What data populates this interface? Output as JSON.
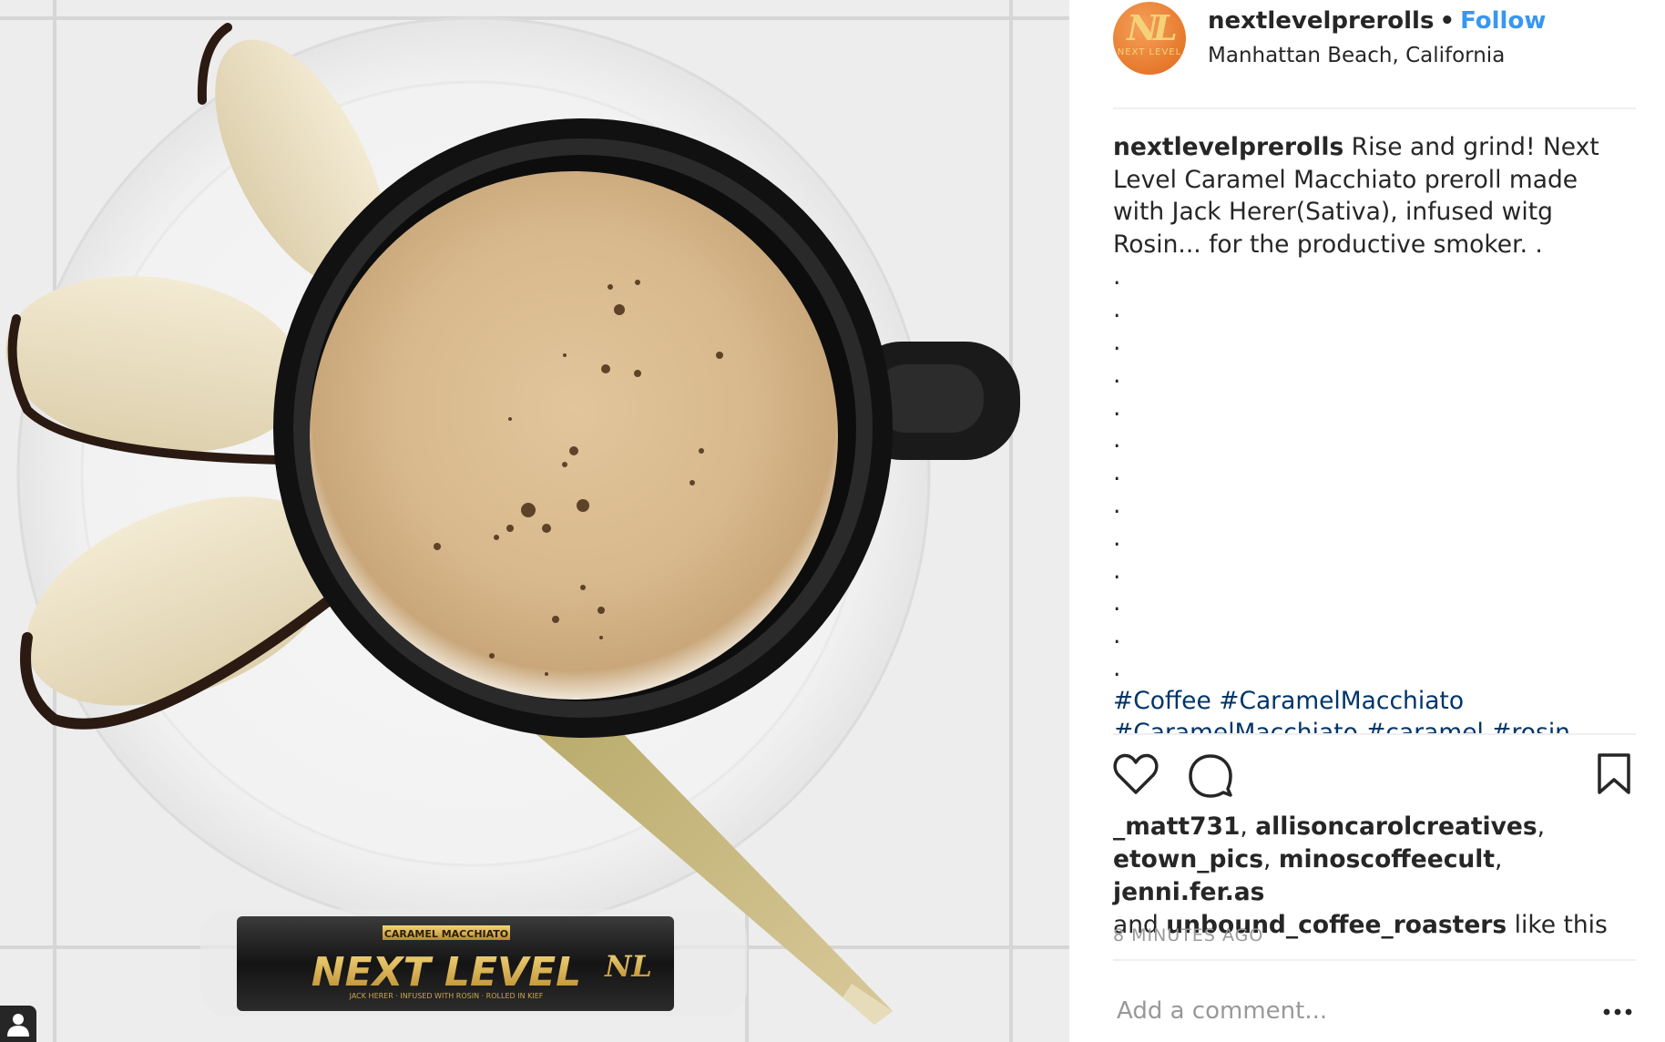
{
  "post": {
    "username": "nextlevelprerolls",
    "follow_label": "Follow",
    "separator": "•",
    "location": "Manhattan Beach, California",
    "avatar": {
      "monogram": "NL",
      "subtext": "NEXT LEVEL"
    },
    "caption": {
      "username": "nextlevelprerolls",
      "text": "Rise and grind! Next Level Caramel Macchiato preroll made with Jack Herer(Sativa), infused witg Rosin... for the productive smoker. .",
      "dots": [
        ".",
        ".",
        ".",
        ".",
        ".",
        ".",
        ".",
        ".",
        ".",
        ".",
        ".",
        ".",
        "."
      ],
      "hashtags": [
        "#Coffee",
        "#CaramelMacchiato"
      ],
      "hashtags_cut": "#CaramelMacchiato #caramel #rosin #kief"
    },
    "likes": {
      "users_line1": [
        "_matt731",
        "allisoncarolcreatives"
      ],
      "users_line2": [
        "etown_pics",
        "minoscoffeecult",
        "jenni.fer.as"
      ],
      "and_label": "and",
      "last_user": "unbound_coffee_roasters",
      "suffix": "like this"
    },
    "timestamp": "8 MINUTES AGO",
    "comment_placeholder": "Add a comment...",
    "more_label": "•••"
  },
  "photo": {
    "tube_top_label": "CARAMEL MACCHIATO",
    "tube_brand": "NEXT LEVEL",
    "tube_sub": "JACK HERER · INFUSED WITH ROSIN · ROLLED IN KIEF",
    "tube_logo": "NL"
  },
  "icons": [
    "heart-icon",
    "comment-icon",
    "bookmark-icon",
    "more-icon",
    "user-tag-icon"
  ]
}
